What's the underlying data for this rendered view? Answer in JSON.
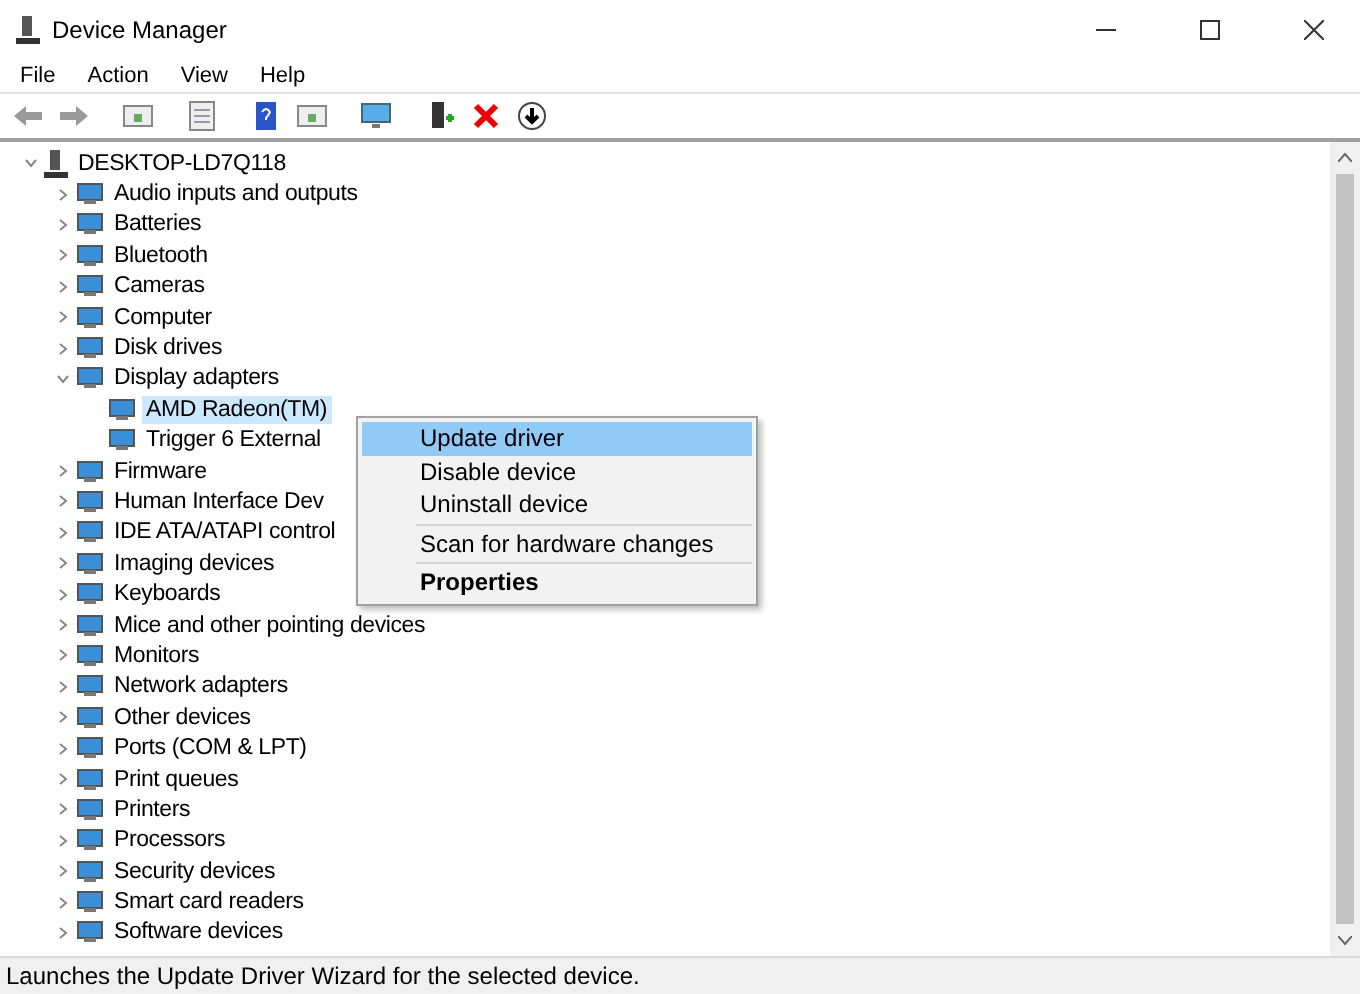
{
  "window": {
    "title": "Device Manager"
  },
  "menu": [
    "File",
    "Action",
    "View",
    "Help"
  ],
  "tree": [
    {
      "label": "DESKTOP-LD7Q118",
      "expanded": true,
      "selected": false,
      "children": [
        {
          "label": "Audio inputs and outputs",
          "expanded": false,
          "selected": false
        },
        {
          "label": "Batteries",
          "expanded": false,
          "selected": false
        },
        {
          "label": "Bluetooth",
          "expanded": false,
          "selected": false
        },
        {
          "label": "Cameras",
          "expanded": false,
          "selected": false
        },
        {
          "label": "Computer",
          "expanded": false,
          "selected": false
        },
        {
          "label": "Disk drives",
          "expanded": false,
          "selected": false
        },
        {
          "label": "Display adapters",
          "expanded": true,
          "selected": false,
          "children": [
            {
              "label": "AMD Radeon(TM)",
              "selected": true
            },
            {
              "label": "Trigger 6 External",
              "selected": false
            }
          ]
        },
        {
          "label": "Firmware",
          "expanded": false,
          "selected": false
        },
        {
          "label": "Human Interface Dev",
          "expanded": false,
          "selected": false
        },
        {
          "label": "IDE ATA/ATAPI control",
          "expanded": false,
          "selected": false
        },
        {
          "label": "Imaging devices",
          "expanded": false,
          "selected": false
        },
        {
          "label": "Keyboards",
          "expanded": false,
          "selected": false
        },
        {
          "label": "Mice and other pointing devices",
          "expanded": false,
          "selected": false
        },
        {
          "label": "Monitors",
          "expanded": false,
          "selected": false
        },
        {
          "label": "Network adapters",
          "expanded": false,
          "selected": false
        },
        {
          "label": "Other devices",
          "expanded": false,
          "selected": false
        },
        {
          "label": "Ports (COM & LPT)",
          "expanded": false,
          "selected": false
        },
        {
          "label": "Print queues",
          "expanded": false,
          "selected": false
        },
        {
          "label": "Printers",
          "expanded": false,
          "selected": false
        },
        {
          "label": "Processors",
          "expanded": false,
          "selected": false
        },
        {
          "label": "Security devices",
          "expanded": false,
          "selected": false
        },
        {
          "label": "Smart card readers",
          "expanded": false,
          "selected": false
        },
        {
          "label": "Software devices",
          "expanded": false,
          "selected": false
        }
      ]
    }
  ],
  "context_menu": [
    {
      "kind": "item",
      "label": "Update driver",
      "selected": true
    },
    {
      "kind": "item",
      "label": "Disable device",
      "selected": false
    },
    {
      "kind": "item",
      "label": "Uninstall device",
      "selected": false
    },
    {
      "kind": "separator"
    },
    {
      "kind": "item",
      "label": "Scan for hardware changes",
      "selected": false
    },
    {
      "kind": "separator"
    },
    {
      "kind": "default",
      "label": "Properties",
      "selected": false
    }
  ],
  "status_bar": "Launches the Update Driver Wizard for the selected device."
}
